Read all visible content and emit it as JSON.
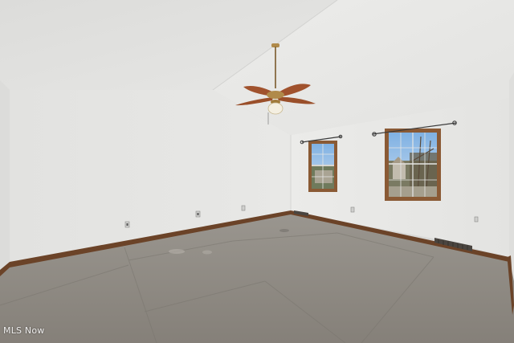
{
  "watermark": {
    "text": "MLS Now"
  },
  "colors": {
    "wall_left": "#e4e4e2",
    "wall_back": "#e9e9e7",
    "ceiling": "#e6e6e4",
    "floor": "#8e8b85",
    "baseboard": "#6b4328",
    "window_frame": "#8a5a35",
    "fan_blade": "#a0522d",
    "fan_metal": "#b08a4a"
  },
  "scene": {
    "description_icons": [
      "ceiling-fan-icon",
      "window-icon",
      "curtain-rod-icon",
      "outlet-icon",
      "floor-vent-icon"
    ]
  }
}
